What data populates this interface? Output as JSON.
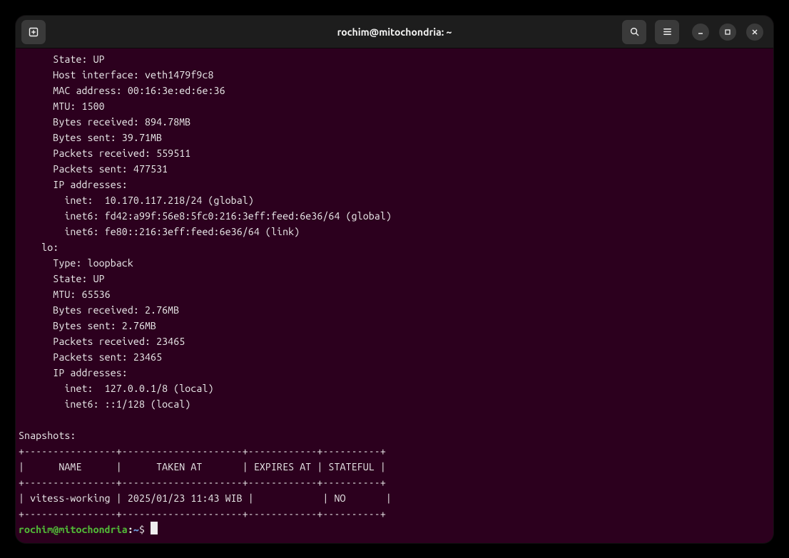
{
  "window": {
    "title": "rochim@mitochondria: ~"
  },
  "output": {
    "lines": [
      "      State: UP",
      "      Host interface: veth1479f9c8",
      "      MAC address: 00:16:3e:ed:6e:36",
      "      MTU: 1500",
      "      Bytes received: 894.78MB",
      "      Bytes sent: 39.71MB",
      "      Packets received: 559511",
      "      Packets sent: 477531",
      "      IP addresses:",
      "        inet:  10.170.117.218/24 (global)",
      "        inet6: fd42:a99f:56e8:5fc0:216:3eff:feed:6e36/64 (global)",
      "        inet6: fe80::216:3eff:feed:6e36/64 (link)",
      "    lo:",
      "      Type: loopback",
      "      State: UP",
      "      MTU: 65536",
      "      Bytes received: 2.76MB",
      "      Bytes sent: 2.76MB",
      "      Packets received: 23465",
      "      Packets sent: 23465",
      "      IP addresses:",
      "        inet:  127.0.0.1/8 (local)",
      "        inet6: ::1/128 (local)",
      "",
      "Snapshots:",
      "+----------------+---------------------+------------+----------+",
      "|      NAME      |      TAKEN AT       | EXPIRES AT | STATEFUL |",
      "+----------------+---------------------+------------+----------+",
      "| vitess-working | 2025/01/23 11:43 WIB |            | NO       |",
      "+----------------+---------------------+------------+----------+"
    ]
  },
  "prompt": {
    "user_host": "rochim@mitochondria",
    "separator": ":",
    "path": "~",
    "symbol": "$"
  }
}
